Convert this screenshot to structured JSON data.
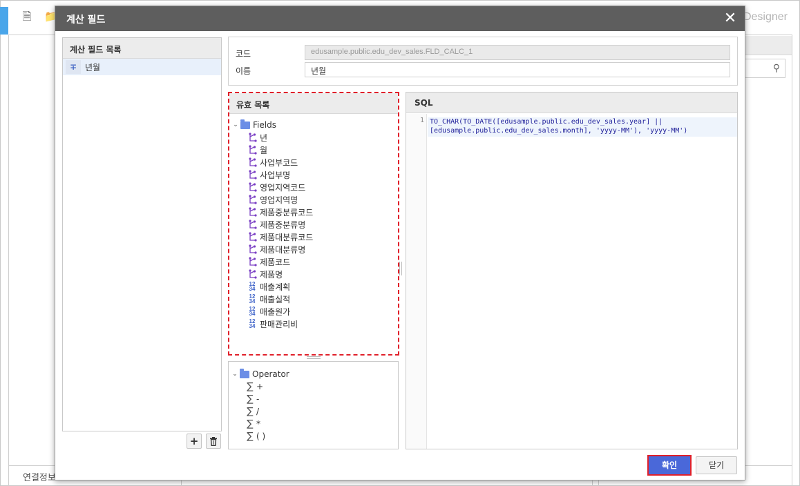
{
  "background": {
    "designer_label": "Designer",
    "connection_label": "연결정보"
  },
  "dialog": {
    "title": "계산 필드",
    "close_icon": "close-icon"
  },
  "calc_list": {
    "header": "계산 필드 목록",
    "items": [
      {
        "icon": "calc-field-icon",
        "label": "년월"
      }
    ],
    "add_label": "+",
    "delete_icon": "trash-icon"
  },
  "info": {
    "code_label": "코드",
    "code_value": "edusample.public.edu_dev_sales.FLD_CALC_1",
    "name_label": "이름",
    "name_value": "년월"
  },
  "valid_list": {
    "header": "유효 목록",
    "folder": "Fields",
    "dimensions": [
      "년",
      "월",
      "사업부코드",
      "사업부명",
      "영업지역코드",
      "영업지역명",
      "제품중분류코드",
      "제품중분류명",
      "제품대분류코드",
      "제품대분류명",
      "제품코드",
      "제품명"
    ],
    "measures": [
      "매출계획",
      "매출실적",
      "매출원가",
      "판매관리비"
    ]
  },
  "operators": {
    "folder": "Operator",
    "items": [
      "+",
      "-",
      "/",
      "*",
      "( )"
    ]
  },
  "sql": {
    "header": "SQL",
    "line_number": "1",
    "line1": "TO_CHAR(TO_DATE([edusample.public.edu_dev_sales.year] ||",
    "line2": "[edusample.public.edu_dev_sales.month], 'yyyy-MM'), 'yyyy-MM')"
  },
  "footer": {
    "ok_label": "확인",
    "close_label": "닫기"
  },
  "colors": {
    "titlebar": "#5e5e5e",
    "accent_blue": "#4a68d9",
    "highlight_red": "#e0202a"
  }
}
